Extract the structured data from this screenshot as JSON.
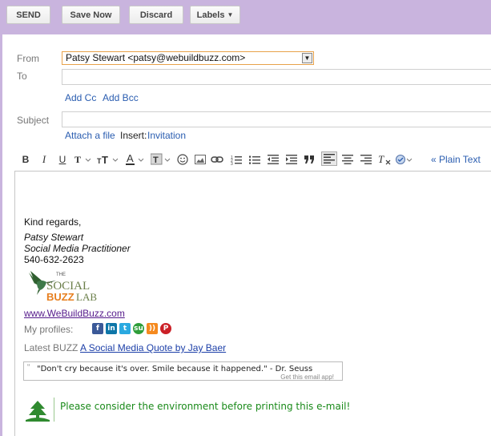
{
  "toolbar": {
    "send_label": "SEND",
    "save_label": "Save Now",
    "discard_label": "Discard",
    "labels_label": "Labels"
  },
  "compose": {
    "from_label": "From",
    "from_value": "Patsy Stewart <patsy@webuildbuzz.com>",
    "to_label": "To",
    "to_value": "",
    "add_cc": "Add Cc",
    "add_bcc": "Add Bcc",
    "subject_label": "Subject",
    "subject_value": "",
    "attach_link": "Attach a file",
    "insert_label": "Insert:",
    "invitation_link": "Invitation"
  },
  "format_toolbar": {
    "bold": "B",
    "italic": "I",
    "underline": "U",
    "plain_text_link": "« Plain Text"
  },
  "body": {
    "closing": "Kind regards,",
    "name": "Patsy Stewart",
    "title": "Social Media Practitioner",
    "phone": "540-632-2623",
    "logo_the": "THE",
    "logo_social": "SOCIAL",
    "logo_buzz": "BUZZ",
    "logo_lab": "LAB",
    "website": "www.WeBuildBuzz.com",
    "profiles_label": "My profiles:",
    "latest_label": "Latest BUZZ",
    "latest_link": "A Social Media Quote by Jay Baer",
    "quote": "\"Don't cry because it's over. Smile because it happened.\" - Dr. Seuss",
    "quote_footer": "Get this email app!",
    "eco_message": "Please consider the environment before printing this e-mail!"
  },
  "social_icons": [
    "facebook-icon",
    "linkedin-icon",
    "twitter-icon",
    "stumbleupon-icon",
    "rss-icon",
    "pinterest-icon"
  ],
  "colors": {
    "topbar": "#c9b4de",
    "link": "#2a5db0",
    "eco_green": "#1a8a1a"
  }
}
